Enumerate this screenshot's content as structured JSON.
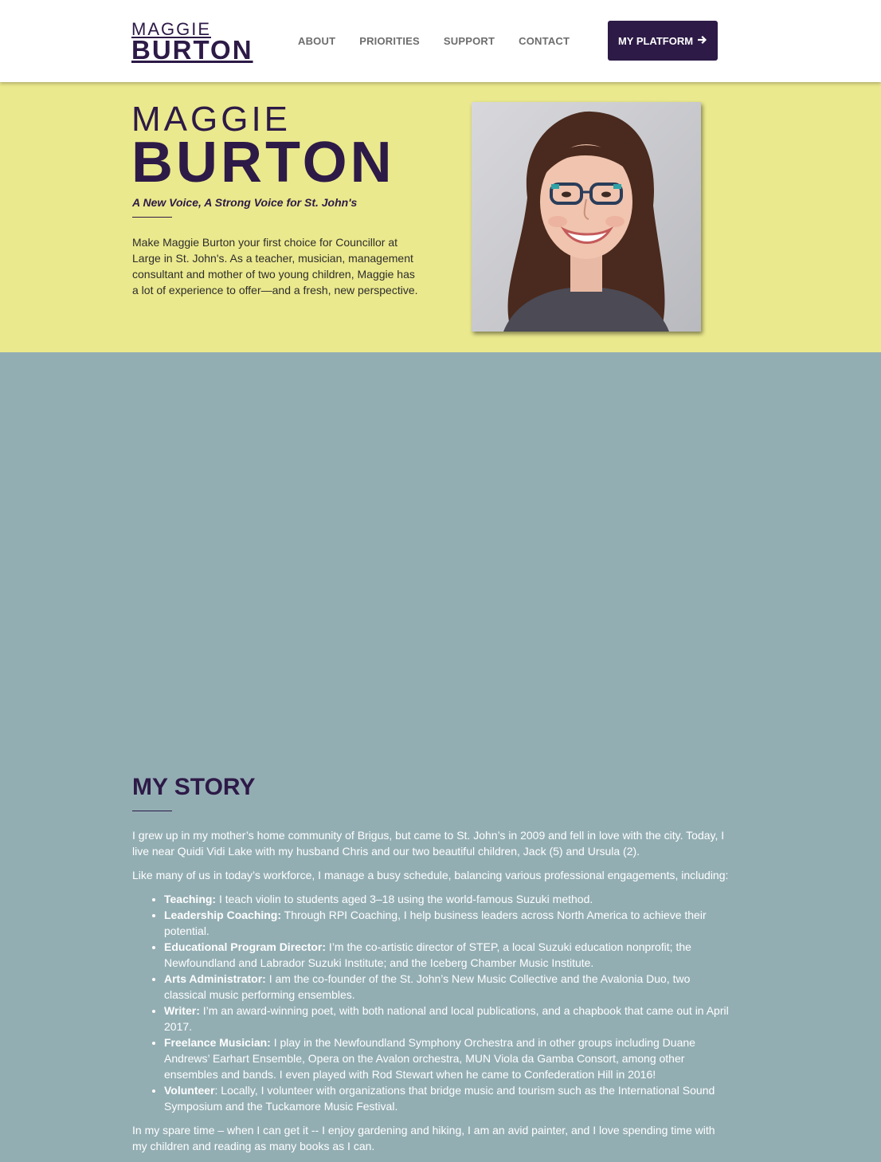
{
  "header": {
    "logo_first": "MAGGIE",
    "logo_last": "BURTON",
    "nav": [
      "ABOUT",
      "PRIORITIES",
      "SUPPORT",
      "CONTACT"
    ],
    "cta_label": "MY PLATFORM",
    "cta_icon": "arrow-right-icon"
  },
  "hero": {
    "name_first": "MAGGIE",
    "name_last": "BURTON",
    "tagline": "A New Voice, A Strong Voice for St. John's",
    "intro": "Make Maggie Burton your first choice for Councillor at Large in St. John's. As a teacher, musician, management consultant and mother of two young children, Maggie has a lot of experience to offer—and a fresh, new perspective.",
    "photo": "portrait-photo",
    "colors": {
      "background": "#ebe98d",
      "brand": "#2d1a47"
    }
  },
  "story": {
    "title": "MY STORY",
    "p1": "I grew up in my mother’s home community of Brigus, but came to St. John’s in 2009 and fell in love with the city. Today, I live near Quidi Vidi Lake with my husband Chris and our two beautiful children, Jack (5) and Ursula (2).",
    "p2": "Like many of us in today’s workforce, I manage a busy schedule, balancing various professional engagements, including:",
    "items": [
      {
        "label": "Teaching:",
        "text": " I teach violin to students aged 3–18 using the world-famous Suzuki method."
      },
      {
        "label": "Leadership Coaching:",
        "text": " Through RPI Coaching, I help business leaders across North America to achieve their potential."
      },
      {
        "label": "Educational Program Director:",
        "text": " I’m the co-artistic director of STEP, a local Suzuki education nonprofit; the Newfoundland and Labrador Suzuki Institute; and the Iceberg Chamber Music Institute."
      },
      {
        "label": "Arts Administrator:",
        "text": " I am the co-founder of the St. John’s New Music Collective and the Avalonia Duo, two classical music performing ensembles."
      },
      {
        "label": "Writer:",
        "text": " I’m an award-winning poet, with both national and local publications, and a chapbook that came out in April 2017."
      },
      {
        "label": "Freelance Musician:",
        "text": " I play in the Newfoundland Symphony Orchestra and in other groups including Duane Andrews’ Earhart Ensemble, Opera on the Avalon orchestra, MUN Viola da Gamba Consort, among other ensembles and bands. I even played with Rod Stewart when he came to Confederation Hill in 2016!"
      },
      {
        "label": "Volunteer",
        "text": ": Locally, I volunteer with organizations that bridge music and tourism such as the International Sound Symposium and the Tuckamore Music Festival."
      }
    ],
    "p3": "In my spare time – when I can get it -- I enjoy gardening and hiking, I am an avid painter, and I love spending time with my children and reading as many books as I can.",
    "colors": {
      "background": "#93aeb3"
    }
  }
}
